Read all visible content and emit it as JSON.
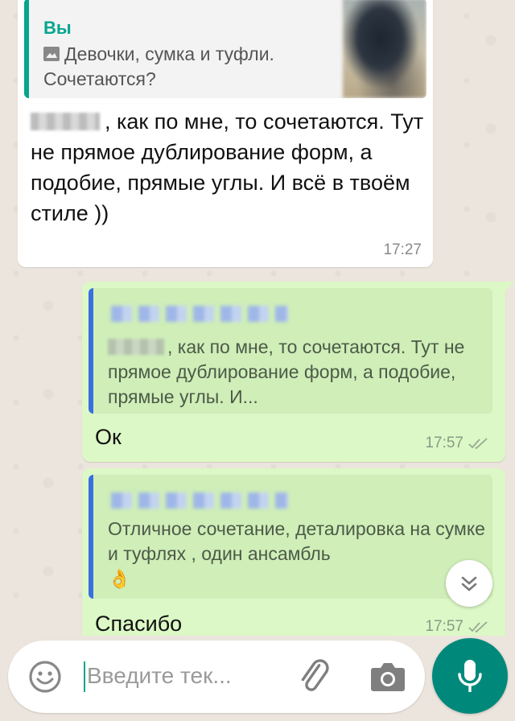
{
  "incoming": {
    "quote_author": "Вы",
    "quote_icon": "photo-icon",
    "quote_text": "Девочки, сумка и туфли. Сочетаются?",
    "text": ", как по мне, то сочетаются. Тут не прямое дублирование форм, а подобие, прямые углы. И всё в твоём стиле ))",
    "time": "17:27"
  },
  "outgoing": [
    {
      "quote_text": ", как по мне, то сочетаются. Тут не прямое дублирование форм, а подобие, прямые углы. И...",
      "text": "Ок",
      "time": "17:57",
      "status_icon": "double-check-icon"
    },
    {
      "quote_text": "Отличное сочетание, деталировка на сумке и туфлях , один ансамбль",
      "quote_emoji": "👌",
      "text": "Спасибо",
      "time": "17:57",
      "status_icon": "double-check-icon"
    }
  ],
  "composer": {
    "placeholder": "Введите тек...",
    "emoji_icon": "emoji-icon",
    "attach_icon": "paperclip-icon",
    "camera_icon": "camera-icon",
    "mic_icon": "mic-icon"
  },
  "colors": {
    "accent": "#06a58e",
    "outgoing_bubble": "#dcf8c6",
    "mic_button": "#00897b",
    "quote_bar_blue": "#3a6fe0"
  }
}
